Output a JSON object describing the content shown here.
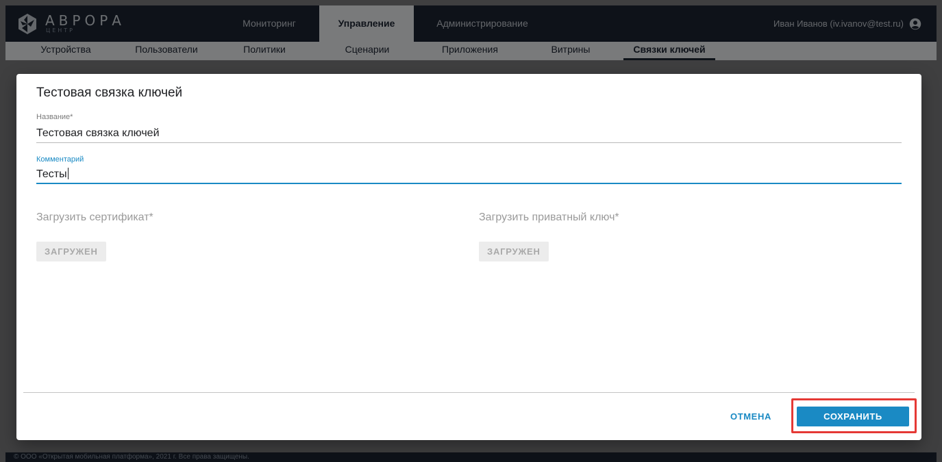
{
  "header": {
    "logo_name": "АВРОРА",
    "logo_sub": "ЦЕНТР",
    "main_tabs": [
      {
        "label": "Мониторинг"
      },
      {
        "label": "Управление",
        "active": true
      },
      {
        "label": "Администрирование"
      }
    ],
    "user": "Иван Иванов (iv.ivanov@test.ru)"
  },
  "subnav": {
    "items": [
      {
        "label": "Устройства"
      },
      {
        "label": "Пользователи"
      },
      {
        "label": "Политики"
      },
      {
        "label": "Сценарии"
      },
      {
        "label": "Приложения"
      },
      {
        "label": "Витрины"
      },
      {
        "label": "Связки ключей",
        "active": true
      }
    ]
  },
  "modal": {
    "title": "Тестовая связка ключей",
    "name_field": {
      "label": "Название*",
      "value": "Тестовая связка ключей"
    },
    "comment_field": {
      "label": "Комментарий",
      "value": "Тесты"
    },
    "certificate": {
      "label": "Загрузить сертификат*",
      "button": "ЗАГРУЖЕН"
    },
    "private_key": {
      "label": "Загрузить приватный ключ*",
      "button": "ЗАГРУЖЕН"
    },
    "cancel_label": "ОТМЕНА",
    "save_label": "СОХРАНИТЬ"
  },
  "footer": {
    "text": "© ООО «Открытая мобильная платформа», 2021 г. Все права защищены."
  },
  "colors": {
    "accent": "#1a8ac4",
    "header_bg": "#1c2533",
    "highlight": "#e53935"
  }
}
